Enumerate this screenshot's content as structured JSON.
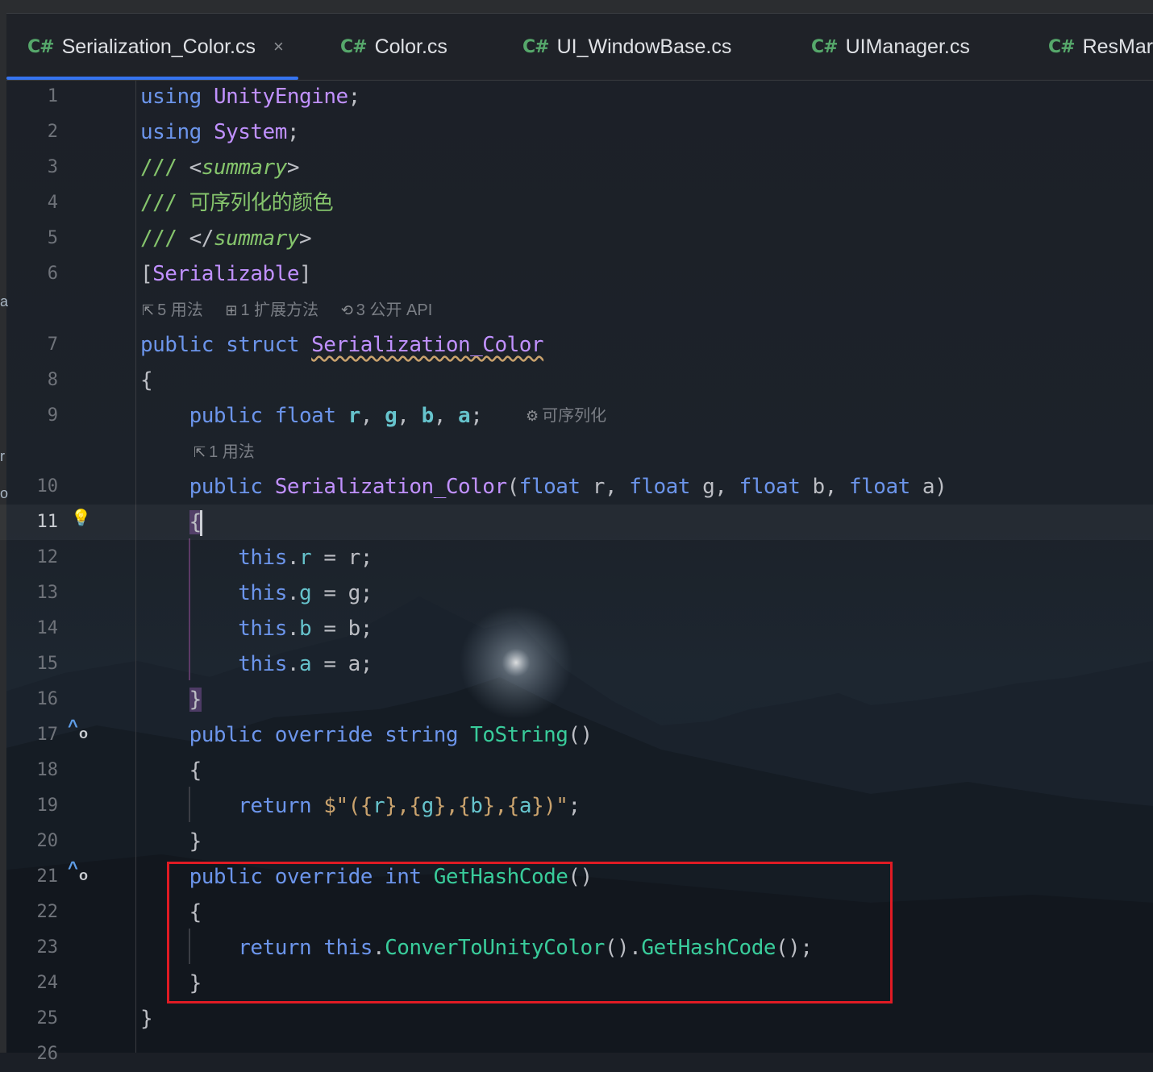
{
  "tabs": [
    {
      "icon": "C#",
      "label": "Serialization_Color.cs",
      "close": "×",
      "active": true
    },
    {
      "icon": "C#",
      "label": "Color.cs"
    },
    {
      "icon": "C#",
      "label": "UI_WindowBase.cs"
    },
    {
      "icon": "C#",
      "label": "UIManager.cs"
    },
    {
      "icon": "C#",
      "label": "ResMar"
    }
  ],
  "left_edge_chars": [
    "a",
    "r",
    "o"
  ],
  "line_numbers": [
    "1",
    "2",
    "3",
    "4",
    "5",
    "6",
    "7",
    "8",
    "9",
    "10",
    "11",
    "12",
    "13",
    "14",
    "15",
    "16",
    "17",
    "18",
    "19",
    "20",
    "21",
    "22",
    "23",
    "24",
    "25",
    "26"
  ],
  "code": {
    "l1": {
      "kw": "using",
      "ns": "UnityEngine",
      "p": ";"
    },
    "l2": {
      "kw": "using",
      "ns": "System",
      "p": ";"
    },
    "l3": {
      "slash": "/// ",
      "lt": "<",
      "tag": "summary",
      "gt": ">"
    },
    "l4": {
      "text": "/// 可序列化的颜色"
    },
    "l5": {
      "slash": "/// ",
      "lt": "</",
      "tag": "summary",
      "gt": ">"
    },
    "l6": {
      "open": "[",
      "attr": "Serializable",
      "close": "]"
    },
    "l7": {
      "kw1": "public",
      "kw2": "struct",
      "name": "Serialization_Color"
    },
    "l8": {
      "text": "{"
    },
    "l9": {
      "kw1": "public",
      "kw2": "float",
      "f1": "r",
      "f2": "g",
      "f3": "b",
      "f4": "a",
      "sep": ", ",
      "end": ";"
    },
    "l10": {
      "kw1": "public",
      "name": "Serialization_Color",
      "open": "(",
      "t": "float",
      "p1": " r, ",
      "p2": " g, ",
      "p3": " b, ",
      "p4": " a)"
    },
    "l11": {
      "text": "{"
    },
    "l12": {
      "this": "this",
      "dot": ".",
      "field": "r",
      "rest": " = r;"
    },
    "l13": {
      "this": "this",
      "dot": ".",
      "field": "g",
      "rest": " = g;"
    },
    "l14": {
      "this": "this",
      "dot": ".",
      "field": "b",
      "rest": " = b;"
    },
    "l15": {
      "this": "this",
      "dot": ".",
      "field": "a",
      "rest": " = a;"
    },
    "l16": {
      "text": "}"
    },
    "l17": {
      "kw1": "public",
      "kw2": "override",
      "kw3": "string",
      "fn": "ToString",
      "paren": "()"
    },
    "l18": {
      "text": "{"
    },
    "l19": {
      "kw": "return",
      "s1": "$\"(",
      "lb": "{",
      "v1": "r",
      "rb": "}",
      "c": ",",
      "v2": "g",
      "v3": "b",
      "v4": "a",
      "s2": ")\"",
      "end": ";"
    },
    "l20": {
      "text": "}"
    },
    "l21": {
      "kw1": "public",
      "kw2": "override",
      "kw3": "int",
      "fn": "GetHashCode",
      "paren": "()"
    },
    "l22": {
      "text": "{"
    },
    "l23": {
      "kw": "return",
      "this": "this",
      "dot": ".",
      "fn1": "ConverToUnityColor",
      "p1": "().",
      "fn2": "GetHashCode",
      "p2": "();"
    },
    "l24": {
      "text": "}"
    },
    "l25": {
      "text": "}"
    }
  },
  "hints": {
    "struct_usages": {
      "icon": "⇱",
      "text": "5 用法"
    },
    "extension_methods": {
      "icon": "⊞",
      "text": "1 扩展方法"
    },
    "public_api": {
      "icon": "⟲",
      "text": "3 公开 API"
    },
    "serializable_hint": {
      "icon": "⚙",
      "text": "可序列化"
    },
    "ctor_usages": {
      "icon": "⇱",
      "text": "1 用法"
    }
  },
  "gutter_icons": {
    "bulb": "💡",
    "override_up": "^",
    "override_dot": "o"
  },
  "colors": {
    "keyword": "#6c95eb",
    "type": "#c191ff",
    "comment": "#85c46c",
    "method": "#39cc9b",
    "field": "#66c3cc",
    "string": "#c9a26d",
    "highlight_box": "#e01b24",
    "tab_accent": "#3574f0"
  }
}
